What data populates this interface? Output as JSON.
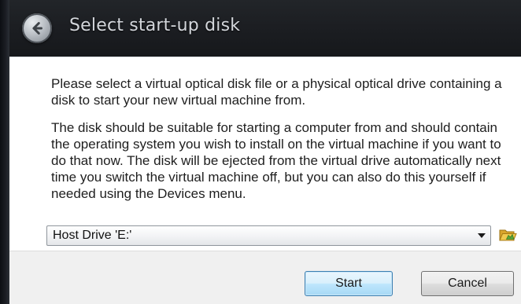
{
  "window": {
    "title": "Select start-up disk"
  },
  "content": {
    "paragraph_1": "Please select a virtual optical disk file or a physical optical drive containing a disk to start your new virtual machine from.",
    "paragraph_2": "The disk should be suitable for starting a computer from and should contain the operating system you wish to install on the virtual machine if you want to do that now. The disk will be ejected from the virtual drive automatically next time you switch the virtual machine off, but you can also do this yourself if needed using the Devices menu."
  },
  "disk_select": {
    "selected_value": "Host Drive 'E:'"
  },
  "buttons": {
    "start_label": "Start",
    "cancel_label": "Cancel"
  },
  "icons": {
    "back": "back-arrow-icon",
    "dropdown": "chevron-down-icon",
    "folder": "folder-open-icon"
  },
  "colors": {
    "titlebar": "#1b1d21",
    "title_text": "#d3d6db",
    "start_button_border": "#3c7fb1",
    "folder_icon_yellow": "#e8b93a",
    "folder_icon_green": "#5aa63a"
  }
}
